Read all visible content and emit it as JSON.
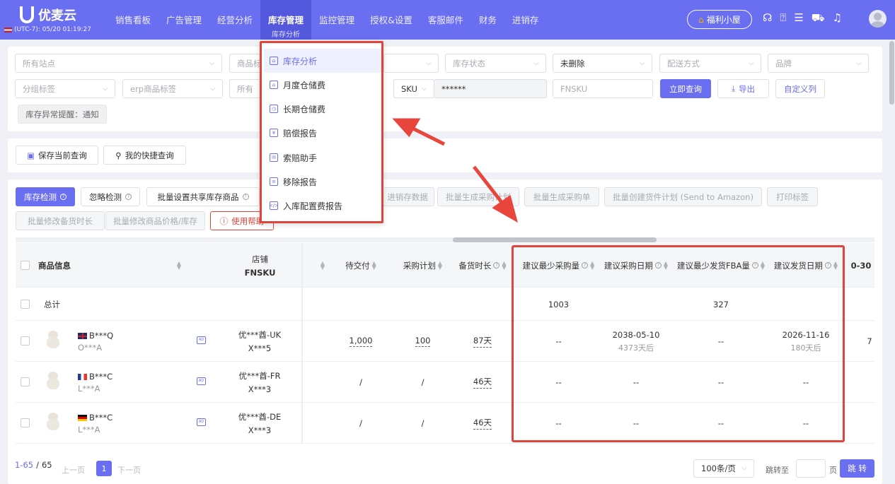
{
  "brand": {
    "name": "优麦云",
    "time": "(UTC-7): 05/20 01:19:27"
  },
  "nav": [
    {
      "label": "销售看板"
    },
    {
      "label": "广告管理"
    },
    {
      "label": "经营分析"
    },
    {
      "label": "库存管理",
      "sub": "库存分析",
      "active": true
    },
    {
      "label": "监控管理"
    },
    {
      "label": "授权&设置"
    },
    {
      "label": "客服邮件"
    },
    {
      "label": "财务"
    },
    {
      "label": "进销存"
    }
  ],
  "header": {
    "welfare": "福利小屋",
    "icons": [
      "headset-icon",
      "help-icon",
      "message-icon",
      "cart-icon",
      "bell-icon"
    ]
  },
  "filters": {
    "site": "所有站点",
    "product": "商品标",
    "warehouse_empty": "",
    "stock_status": "库存状态",
    "deleted": "未删除",
    "delivery": "配送方式",
    "brand": "品牌",
    "group": "分组标签",
    "erp": "erp商品标签",
    "all_prefix": "所有",
    "sku_type": "SKU",
    "sku_value": "******",
    "fnsku_placeholder": "FNSKU",
    "query": "立即查询",
    "export": "导出",
    "custom_cols": "自定义列",
    "alert": "库存异常提醒：通知"
  },
  "quick": {
    "save": "保存当前查询",
    "mine": "我的快捷查询"
  },
  "actions": {
    "inventory_check": "库存检测",
    "ignore_check": "忽略检测",
    "batch_share": "批量设置共享库存商品",
    "sales_data": "进销存数据",
    "batch_plan": "批量生成采购计划",
    "batch_po": "批量生成采购单",
    "batch_shipment": "批量创建货件计划 (Send to Amazon)",
    "print": "打印标签",
    "batch_lead": "批量修改备货时长",
    "batch_price": "批量修改商品价格/库存",
    "help": "使用帮助"
  },
  "dropdown": [
    {
      "label": "库存分析",
      "icon": "warehouse-icon",
      "active": true
    },
    {
      "label": "月度仓储费",
      "icon": "house-icon"
    },
    {
      "label": "长期仓储费",
      "icon": "house-clock-icon"
    },
    {
      "label": "赔偿报告",
      "icon": "compensation-icon"
    },
    {
      "label": "索赔助手",
      "icon": "claim-icon"
    },
    {
      "label": "移除报告",
      "icon": "remove-report-icon"
    },
    {
      "label": "入库配置费报告",
      "icon": "inbound-fee-icon"
    }
  ],
  "table": {
    "headers": {
      "product": "商品信息",
      "shop": "店铺",
      "fnsku": "FNSKU",
      "pending": "待交付",
      "plan": "采购计划",
      "lead": "备货时长",
      "min_po": "建议最少采购量",
      "po_date": "建议采购日期",
      "min_fba": "建议最少发货FBA量",
      "ship_date": "建议发货日期",
      "age": "0-30"
    },
    "total": {
      "label": "总计",
      "min_po": "1003",
      "min_fba": "327"
    },
    "rows": [
      {
        "flag": "uk",
        "asin": "B***Q",
        "sku": "O***A",
        "shop": "优***酋-UK",
        "fnsku": "X***5",
        "pending": "1,000",
        "plan": "100",
        "lead": "87天",
        "min_po": "--",
        "po_date": "2038-05-10",
        "po_sub": "4373天后",
        "min_fba": "--",
        "ship_date": "2026-11-16",
        "ship_sub": "180天后",
        "age": "7"
      },
      {
        "flag": "fr",
        "asin": "B***C",
        "sku": "L***A",
        "shop": "优***酋-FR",
        "fnsku": "X***3",
        "pending": "/",
        "plan": "/",
        "lead": "46天",
        "min_po": "--",
        "po_date": "--",
        "po_sub": "",
        "min_fba": "--",
        "ship_date": "--",
        "ship_sub": "",
        "age": ""
      },
      {
        "flag": "de",
        "asin": "B***C",
        "sku": "L***A",
        "shop": "优***酋-DE",
        "fnsku": "X***3",
        "pending": "/",
        "plan": "/",
        "lead": "46天",
        "min_po": "--",
        "po_date": "--",
        "po_sub": "",
        "min_fba": "--",
        "ship_date": "--",
        "ship_sub": "",
        "age": ""
      }
    ]
  },
  "pager": {
    "range": "1-65",
    "total": "65",
    "prev": "上一页",
    "page": "1",
    "next": "下一页",
    "size": "100条/页",
    "goto": "跳转至",
    "unit": "页",
    "jump": "跳 转"
  }
}
